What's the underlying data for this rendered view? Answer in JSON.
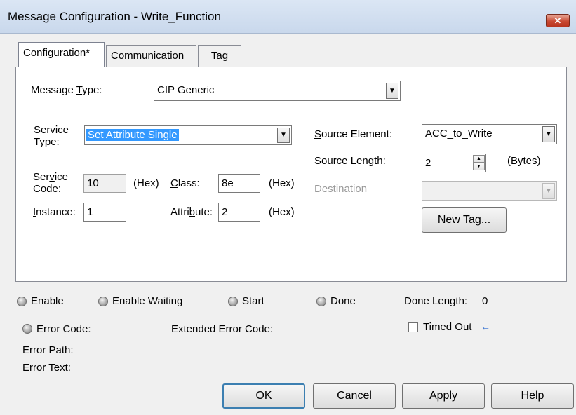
{
  "window": {
    "title": "Message Configuration - Write_Function",
    "close_glyph": "✕"
  },
  "tabs": [
    {
      "label": "Configuration*"
    },
    {
      "label": "Communication"
    },
    {
      "label": "Tag"
    }
  ],
  "config": {
    "message_type": {
      "label_pre": "Message ",
      "label_u": "T",
      "label_post": "ype:",
      "value": "CIP Generic"
    },
    "service_type": {
      "label_line1": "Service",
      "label_line2": "Type:",
      "value": "Set Attribute Single"
    },
    "service_code": {
      "label_line1_pre": "Ser",
      "label_line1_u": "v",
      "label_line1_post": "ice",
      "label_line2": "Code:",
      "value": "10",
      "unit": "(Hex)"
    },
    "class": {
      "label_u": "C",
      "label_post": "lass:",
      "value": "8e",
      "unit": "(Hex)"
    },
    "instance": {
      "label_u": "I",
      "label_post": "nstance:",
      "value": "1"
    },
    "attribute": {
      "label_pre": "Attri",
      "label_u": "b",
      "label_post": "ute:",
      "value": "2",
      "unit": "(Hex)"
    },
    "source_element": {
      "label_u": "S",
      "label_post": "ource Element:",
      "value": "ACC_to_Write"
    },
    "source_length": {
      "label_pre": "Source Le",
      "label_u": "n",
      "label_post": "gth:",
      "value": "2",
      "unit": "(Bytes)"
    },
    "destination": {
      "label_u": "D",
      "label_post": "estination",
      "value": ""
    },
    "new_tag_button": {
      "label_pre": "Ne",
      "label_u": "w",
      "label_post": " Tag..."
    }
  },
  "status": {
    "enable": "Enable",
    "enable_waiting": "Enable Waiting",
    "start": "Start",
    "done": "Done",
    "done_length_label": "Done Length:",
    "done_length_value": "0",
    "error_code": "Error Code:",
    "extended_error_code": "Extended Error Code:",
    "timed_out": "Timed Out",
    "error_path": "Error Path:",
    "error_text": "Error Text:"
  },
  "buttons": {
    "ok": "OK",
    "cancel": "Cancel",
    "apply_u": "A",
    "apply_post": "pply",
    "help": "Help"
  }
}
